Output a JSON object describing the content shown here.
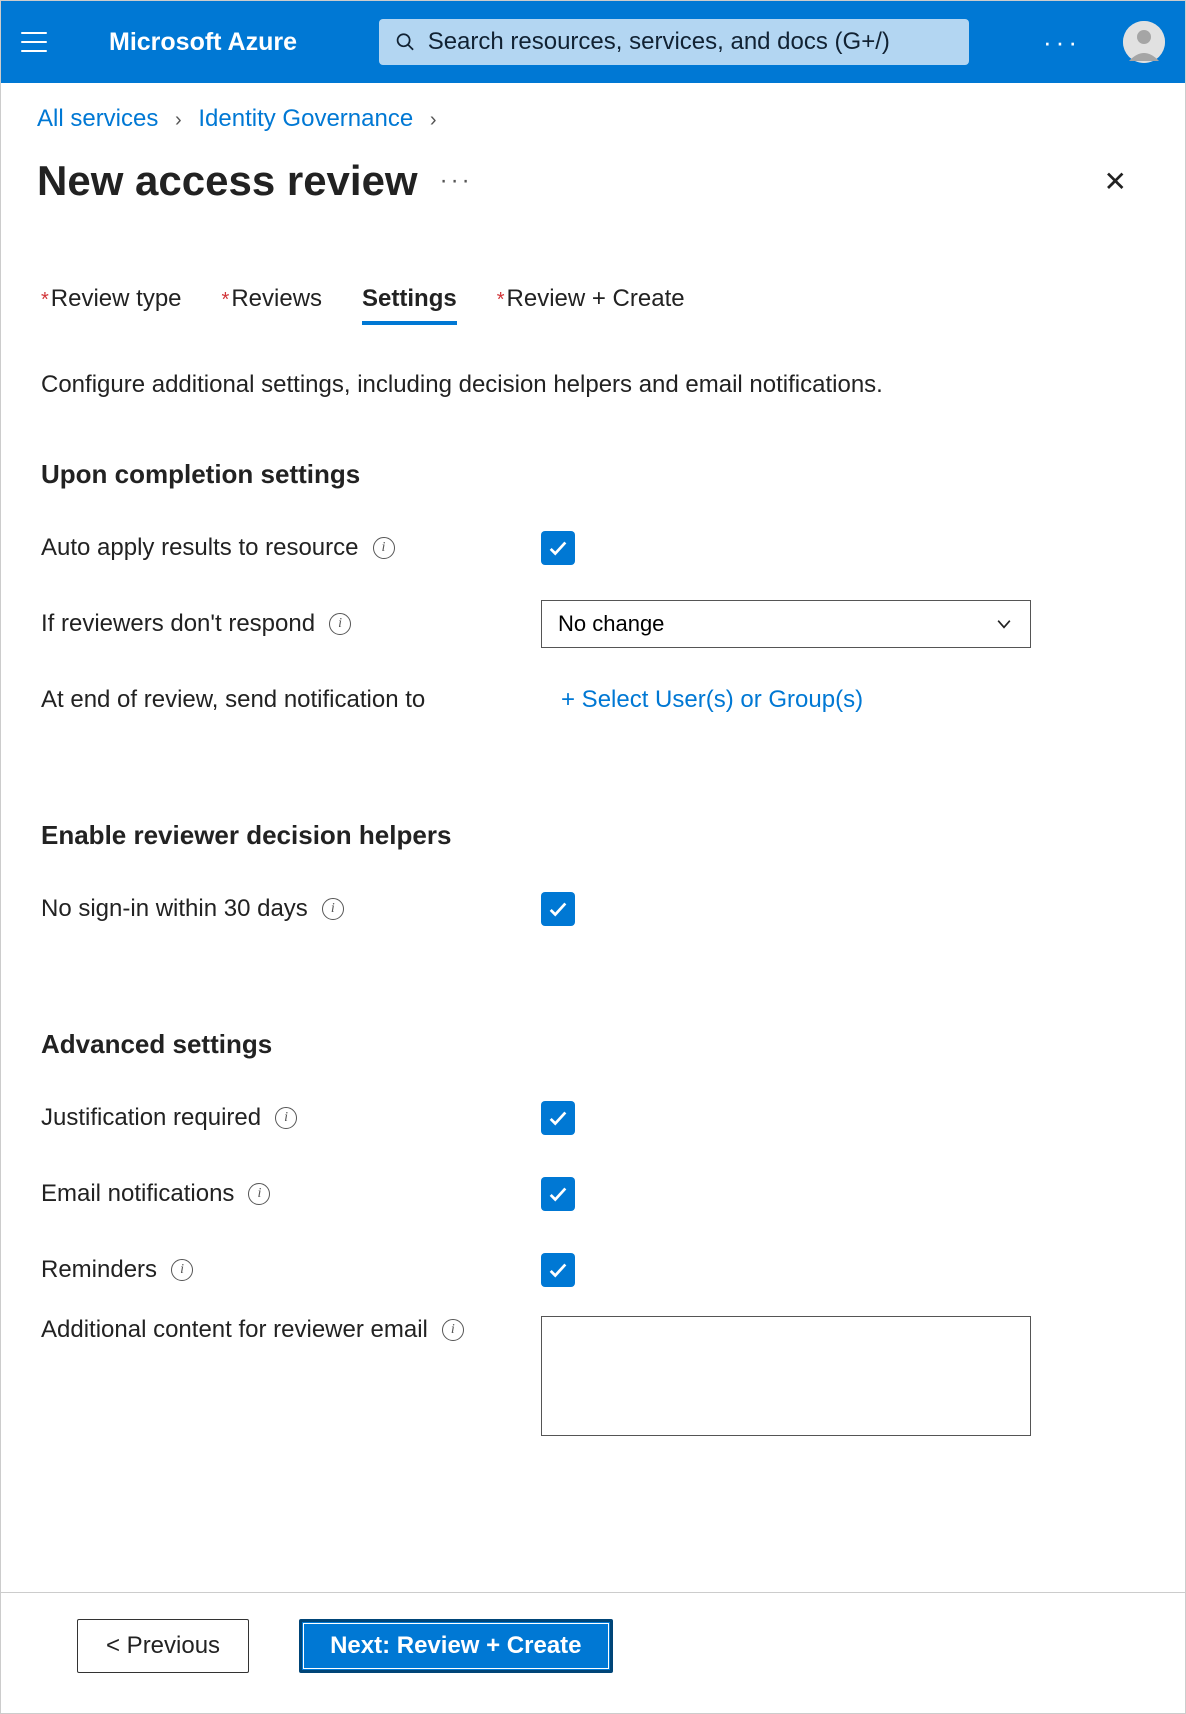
{
  "header": {
    "brand": "Microsoft Azure",
    "search_placeholder": "Search resources, services, and docs (G+/)"
  },
  "breadcrumbs": {
    "items": [
      "All services",
      "Identity Governance"
    ]
  },
  "title": "New access review",
  "tabs": [
    {
      "label": "Review type",
      "required": true,
      "active": false
    },
    {
      "label": "Reviews",
      "required": true,
      "active": false
    },
    {
      "label": "Settings",
      "required": false,
      "active": true
    },
    {
      "label": "Review + Create",
      "required": true,
      "active": false
    }
  ],
  "description": "Configure additional settings, including decision helpers and email notifications.",
  "sections": {
    "completion": {
      "heading": "Upon completion settings",
      "auto_apply_label": "Auto apply results to resource",
      "no_respond_label": "If reviewers don't respond",
      "no_respond_value": "No change",
      "notify_label": "At end of review, send notification to",
      "notify_link": "+ Select User(s) or Group(s)"
    },
    "helpers": {
      "heading": "Enable reviewer decision helpers",
      "no_signin_label": "No sign-in within 30 days"
    },
    "advanced": {
      "heading": "Advanced settings",
      "justification_label": "Justification required",
      "email_label": "Email notifications",
      "reminders_label": "Reminders",
      "additional_content_label": "Additional content for reviewer email"
    }
  },
  "footer": {
    "prev": "< Previous",
    "next": "Next: Review + Create"
  }
}
